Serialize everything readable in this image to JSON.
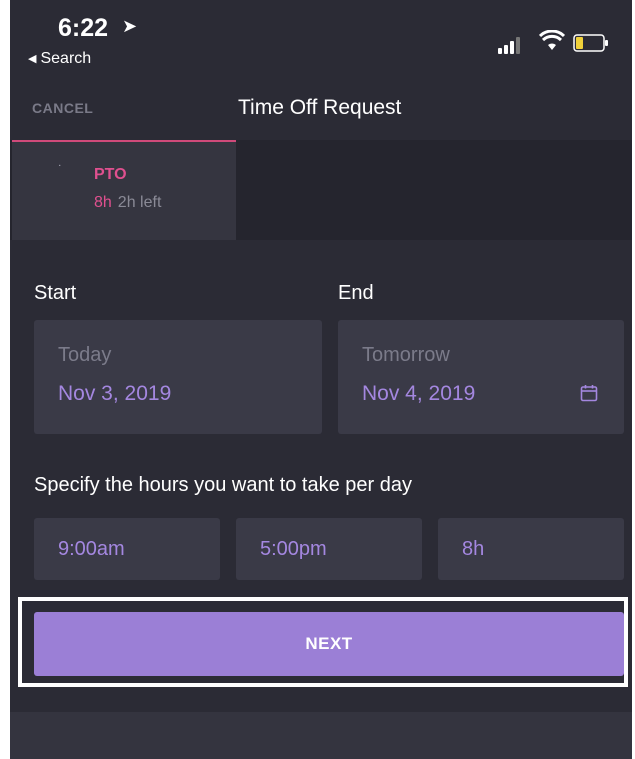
{
  "status_bar": {
    "time": "6:22",
    "back_label": "Search"
  },
  "nav": {
    "cancel_label": "CANCEL",
    "title": "Time Off Request"
  },
  "tabs": [
    {
      "name": "PTO",
      "used": "8h",
      "left": "2h left",
      "selected": true
    }
  ],
  "dates": {
    "start": {
      "label": "Start",
      "hint": "Today",
      "value": "Nov 3, 2019"
    },
    "end": {
      "label": "End",
      "hint": "Tomorrow",
      "value": "Nov 4, 2019"
    }
  },
  "hours": {
    "label": "Specify the hours you want to take per day",
    "start_time": "9:00am",
    "end_time": "5:00pm",
    "total": "8h"
  },
  "next_label": "NEXT",
  "colors": {
    "background": "#2b2b35",
    "card": "#3a3a47",
    "accent_purple": "#a487e0",
    "button": "#9b7fd6",
    "pto_pink": "#e0508f"
  }
}
